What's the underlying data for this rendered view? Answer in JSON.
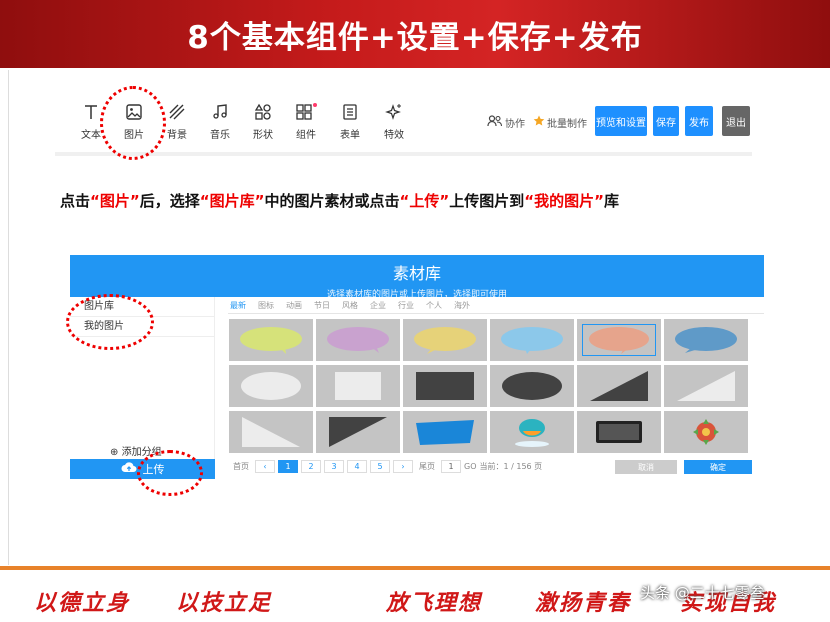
{
  "banner": {
    "title": "8个基本组件+设置+保存+发布"
  },
  "toolbar": {
    "tools": [
      {
        "label": "文本",
        "icon": "text-icon"
      },
      {
        "label": "图片",
        "icon": "image-icon"
      },
      {
        "label": "背景",
        "icon": "background-icon"
      },
      {
        "label": "音乐",
        "icon": "music-icon"
      },
      {
        "label": "形状",
        "icon": "shapes-icon"
      },
      {
        "label": "组件",
        "icon": "component-icon"
      },
      {
        "label": "表单",
        "icon": "form-icon"
      },
      {
        "label": "特效",
        "icon": "sparkle-icon"
      }
    ],
    "collab": "协作",
    "batch": "批量制作",
    "preview": "预览和设置",
    "save": "保存",
    "publish": "发布",
    "exit": "退出"
  },
  "instruction": {
    "p1": "点击",
    "q1": "“图片”",
    "p2": "后，选择",
    "q2": "“图片库”",
    "p3": "中的图片素材或点击",
    "q3": "“上传”",
    "p4": "上传图片到",
    "q4": "“我的图片”",
    "p5": "库"
  },
  "library": {
    "title": "素材库",
    "subtitle": "选择素材库的图片或上传图片，选择即可使用",
    "sidebar": [
      "图片库",
      "我的图片"
    ],
    "add_group": "添加分组",
    "upload": "上传",
    "categories": [
      "最新",
      "图标",
      "动画",
      "节日",
      "风格",
      "企业",
      "行业",
      "个人",
      "海外"
    ],
    "pager": {
      "first": "首页",
      "prev": "‹",
      "pages": [
        "1",
        "2",
        "3",
        "4",
        "5"
      ],
      "next": "›",
      "last": "尾页",
      "jump_value": "1",
      "go": "GO",
      "current": "当前：1 / 156 页"
    },
    "cancel": "取消",
    "ok": "确定"
  },
  "colors": {
    "accent": "#2196f3",
    "banner": "#c51b1b",
    "highlight": "#e00000",
    "footer": "#e8822a"
  },
  "footer": {
    "slogans": [
      "以德立身",
      "以技立足",
      "放飞理想",
      "激扬青春",
      "实现自我"
    ],
    "watermark": "头条 @二十七零叁"
  }
}
